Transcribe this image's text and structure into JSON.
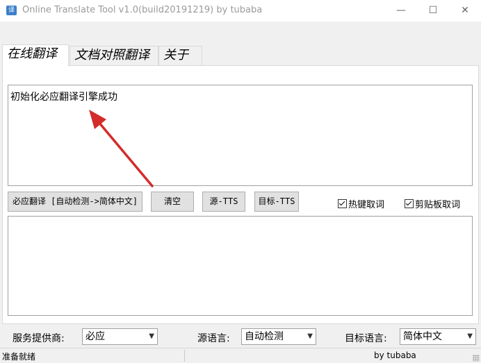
{
  "window": {
    "title": "Online Translate Tool v1.0(build20191219) by tubaba",
    "app_icon_glyph": "译",
    "controls": {
      "minimize": "—",
      "maximize": "☐",
      "close": "✕"
    }
  },
  "tabs": [
    {
      "label": "在线翻译",
      "active": true
    },
    {
      "label": "文档对照翻译",
      "active": false
    },
    {
      "label": "关于",
      "active": false
    }
  ],
  "source_text": "初始化必应翻译引擎成功",
  "translation_text": "",
  "toolbar": {
    "translate_button": "必应翻译 [自动检测->简体中文]",
    "clear_button": "清空",
    "source_tts_button": "源-TTS",
    "target_tts_button": "目标-TTS",
    "hotkey_checkbox": {
      "label": "热键取词",
      "checked": true
    },
    "clipboard_checkbox": {
      "label": "剪贴板取词",
      "checked": true
    }
  },
  "bottom": {
    "provider_label": "服务提供商:",
    "provider_value": "必应",
    "source_lang_label": "源语言:",
    "source_lang_value": "自动检测",
    "target_lang_label": "目标语言:",
    "target_lang_value": "简体中文"
  },
  "status": {
    "text": "准备就绪",
    "author": "by tubaba"
  },
  "colors": {
    "annotation_arrow": "#d42b2b",
    "window_bg": "#f0f0f0"
  }
}
